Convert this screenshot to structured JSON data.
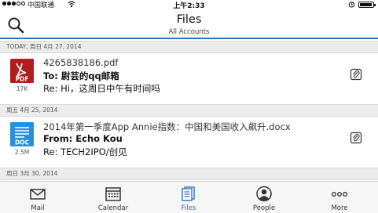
{
  "status_bar": {
    "carrier": "中国联通",
    "time": "上午2:33"
  },
  "nav": {
    "title": "Files",
    "subtitle": "All Accounts",
    "accent_color": "#2f74c0"
  },
  "sections": [
    {
      "header": "TODAY, 周日 4月 27, 2014"
    },
    {
      "header": "周五 4月 25, 2014"
    },
    {
      "header": "周日 3月 30, 2014"
    }
  ],
  "files": [
    {
      "type_label": "PDF",
      "icon": "pdf-file-icon",
      "icon_color": "#b31d1d",
      "size": "17K",
      "name": "4265838186.pdf",
      "from": "To: 尉芸的qq邮箱",
      "subject": "Re: Hi，这周日中午有时间吗"
    },
    {
      "type_label": "DOC",
      "icon": "doc-file-icon",
      "icon_color": "#2b8fd8",
      "size": "2.5M",
      "name": "2014年第一季度App Annie指数：中国和美国收入飙升.docx",
      "from": "From: Echo Kou",
      "subject": "Re: TECH2IPO/创见"
    }
  ],
  "tabs": [
    {
      "label": "Mail",
      "icon": "mail-icon"
    },
    {
      "label": "Calendar",
      "icon": "calendar-icon"
    },
    {
      "label": "Files",
      "icon": "files-icon",
      "active": true
    },
    {
      "label": "People",
      "icon": "people-icon"
    },
    {
      "label": "More",
      "icon": "more-icon"
    }
  ]
}
